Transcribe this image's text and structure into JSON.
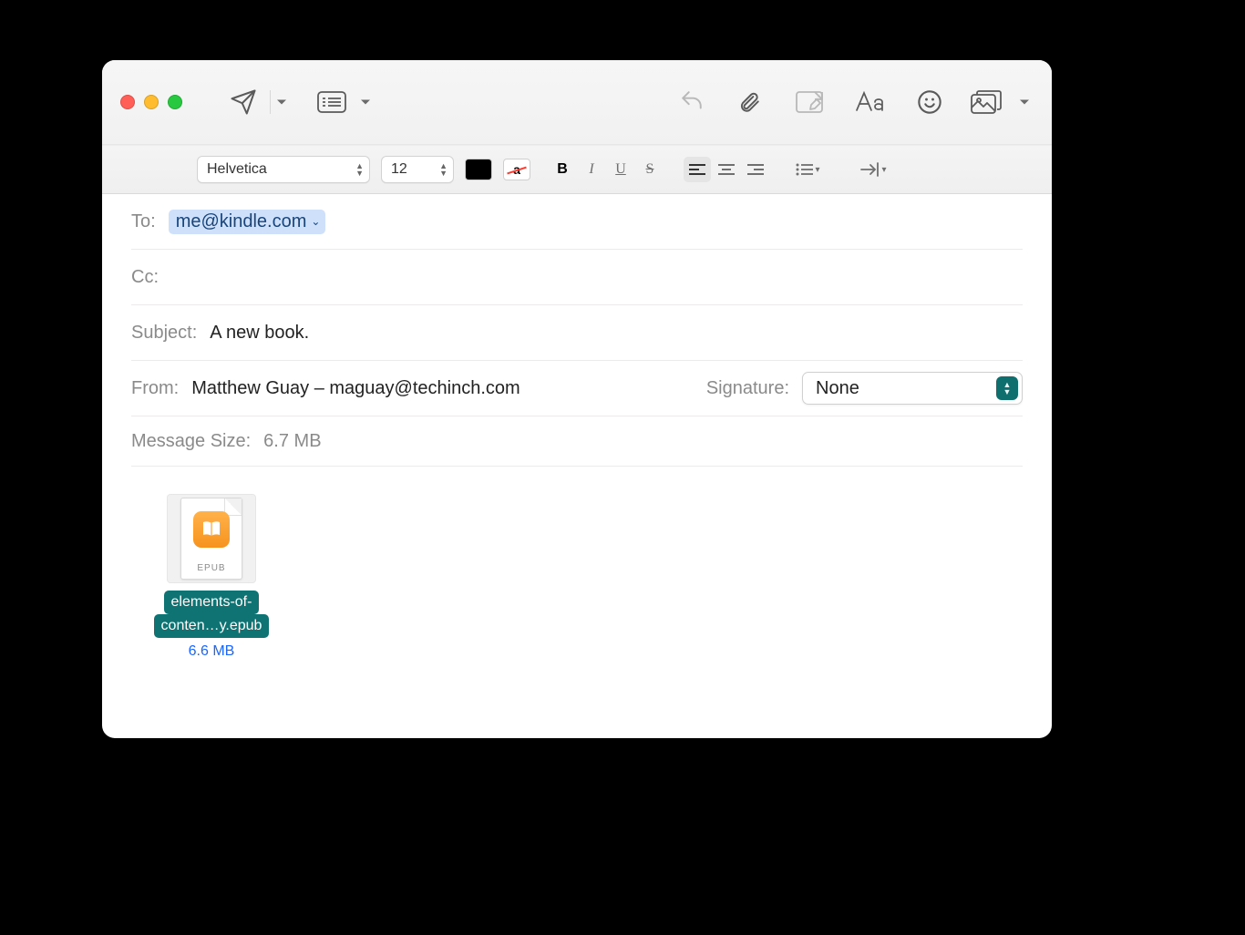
{
  "format": {
    "font": "Helvetica",
    "size": "12"
  },
  "header": {
    "to_label": "To:",
    "to_value": "me@kindle.com",
    "cc_label": "Cc:",
    "cc_value": "",
    "subject_label": "Subject:",
    "subject_value": "A new book.",
    "from_label": "From:",
    "from_value": "Matthew Guay – maguay@techinch.com",
    "signature_label": "Signature:",
    "signature_value": "None",
    "size_label": "Message Size:",
    "size_value": "6.7 MB"
  },
  "attachment": {
    "ext_label": "EPUB",
    "filename_line1": "elements-of-",
    "filename_line2": "conten…y.epub",
    "filesize": "6.6 MB"
  }
}
